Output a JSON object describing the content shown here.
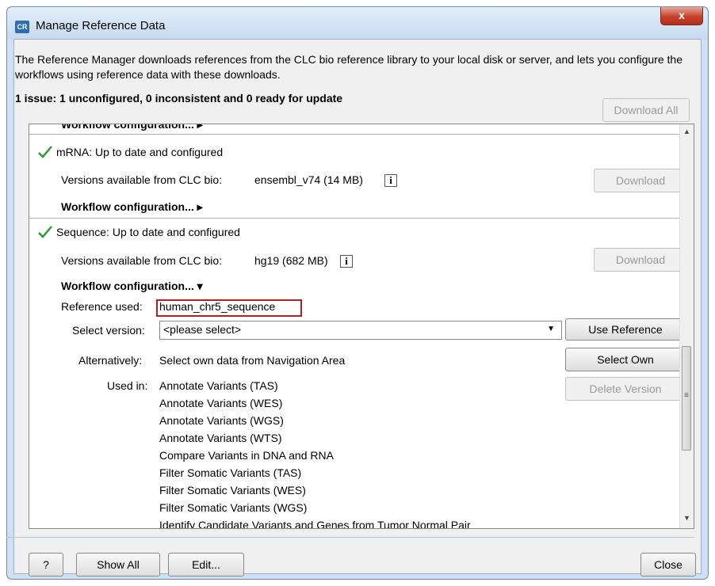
{
  "window": {
    "title": "Manage Reference Data",
    "app_icon": "CR",
    "close_glyph": "x"
  },
  "description": "The Reference Manager downloads references from the CLC bio reference library to your local disk or server, and lets you configure the workflows using reference data with these downloads.",
  "issue_summary": "1 issue: 1 unconfigured, 0 inconsistent and 0 ready for update",
  "download_all_label": "Download All",
  "top_partial_label": "Workflow configuration... ▸",
  "mrna": {
    "status": "mRNA: Up to date and configured",
    "versions_label": "Versions available from CLC bio:",
    "versions_value": "ensembl_v74 (14 MB)",
    "download_label": "Download",
    "workflow_config": "Workflow configuration... ▸"
  },
  "sequence": {
    "status": "Sequence: Up to date and configured",
    "versions_label": "Versions available from CLC bio:",
    "versions_value": "hg19 (682 MB)",
    "download_label": "Download",
    "workflow_config": "Workflow configuration... ▾",
    "reference_used_label": "Reference used:",
    "reference_used_value": "human_chr5_sequence",
    "select_version_label": "Select version:",
    "select_version_value": "<please select>",
    "use_reference_label": "Use Reference",
    "alternatively_label": "Alternatively:",
    "alternatively_value": "Select own data from Navigation Area",
    "select_own_label": "Select Own",
    "delete_version_label": "Delete Version",
    "used_in_label": "Used in:",
    "used_in": [
      "Annotate Variants (TAS)",
      "Annotate Variants (WES)",
      "Annotate Variants (WGS)",
      "Annotate Variants (WTS)",
      "Compare Variants in DNA and RNA",
      "Filter Somatic Variants (TAS)",
      "Filter Somatic Variants (WES)",
      "Filter Somatic Variants (WGS)",
      "Identify Candidate Variants and Genes from Tumor Normal Pair"
    ]
  },
  "footer": {
    "help_label": "?",
    "show_all_label": "Show All",
    "edit_label": "Edit...",
    "close_label": "Close"
  },
  "colors": {
    "check_green": "#2f9a2f",
    "highlight_red": "#b41e1e"
  },
  "icons": [
    "checkmark-icon",
    "info-icon",
    "dropdown-arrow-icon",
    "scroll-up-icon",
    "scroll-down-icon"
  ]
}
